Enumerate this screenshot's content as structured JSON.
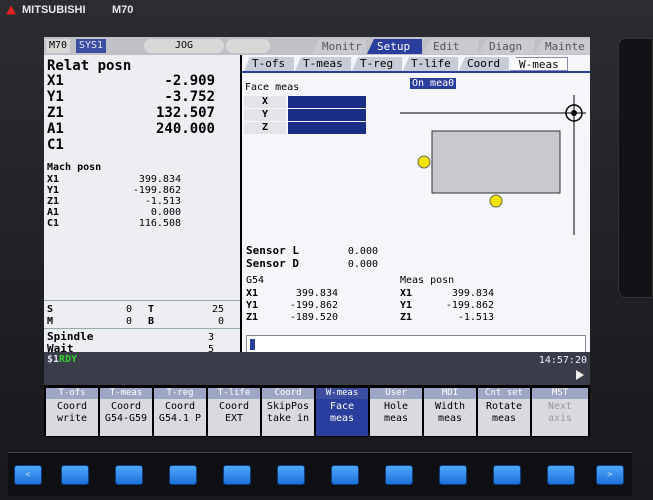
{
  "brand": {
    "name": "MITSUBISHI",
    "model": "M70"
  },
  "topbar": {
    "m70": "M70",
    "sys": "SYS1",
    "mode": "JOG"
  },
  "main_tabs": [
    "Monitr",
    "Setup",
    "Edit",
    "Diagn",
    "Mainte"
  ],
  "active_main_tab": "Setup",
  "sub_tabs": [
    "T-ofs",
    "T-meas",
    "T-reg",
    "T-life",
    "Coord",
    "W-meas"
  ],
  "active_sub_tab": "W-meas",
  "relative": {
    "title": "Relat posn",
    "axes": [
      {
        "name": "X1",
        "value": "-2.909"
      },
      {
        "name": "Y1",
        "value": "-3.752"
      },
      {
        "name": "Z1",
        "value": "132.507"
      },
      {
        "name": "A1",
        "value": "240.000"
      },
      {
        "name": "C1",
        "value": ""
      }
    ]
  },
  "machine": {
    "title": "Mach posn",
    "axes": [
      {
        "name": "X1",
        "value": "399.834"
      },
      {
        "name": "Y1",
        "value": "-199.862"
      },
      {
        "name": "Z1",
        "value": "-1.513"
      },
      {
        "name": "A1",
        "value": "0.000"
      },
      {
        "name": "C1",
        "value": "116.508"
      }
    ]
  },
  "codes": {
    "s_label": "S",
    "s_value": "0",
    "t_label": "T",
    "t_value": "25",
    "m_label": "M",
    "m_value": "0",
    "b_label": "B",
    "b_value": "0"
  },
  "spindle": {
    "label": "Spindle",
    "value": "3"
  },
  "wait": {
    "label": "Wait",
    "value": "5"
  },
  "face": {
    "title": "Face meas",
    "axes": [
      "X",
      "Y",
      "Z"
    ]
  },
  "on_meas": "On mea0",
  "sensor": [
    {
      "label": "Sensor L",
      "value": "0.000"
    },
    {
      "label": "Sensor D",
      "value": "0.000"
    }
  ],
  "g54": {
    "title": "G54",
    "axes": [
      {
        "name": "X1",
        "value": "399.834"
      },
      {
        "name": "Y1",
        "value": "-199.862"
      },
      {
        "name": "Z1",
        "value": "-189.520"
      }
    ]
  },
  "meas": {
    "title": "Meas posn",
    "axes": [
      {
        "name": "X1",
        "value": "399.834"
      },
      {
        "name": "Y1",
        "value": "-199.862"
      },
      {
        "name": "Z1",
        "value": "-1.513"
      }
    ]
  },
  "status": {
    "prefix": "$1",
    "state": "RDY",
    "clock": "14:57:20"
  },
  "softkeys": [
    {
      "top": "T-ofs",
      "bottom1": "Coord",
      "bottom2": "write"
    },
    {
      "top": "T-meas",
      "bottom1": "Coord",
      "bottom2": "G54-G59"
    },
    {
      "top": "T-reg",
      "bottom1": "Coord",
      "bottom2": "G54.1 P"
    },
    {
      "top": "T-life",
      "bottom1": "Coord",
      "bottom2": "EXT"
    },
    {
      "top": "Coord",
      "bottom1": "SkipPos",
      "bottom2": "take in"
    },
    {
      "top": "W-meas",
      "bottom1": "Face",
      "bottom2": "meas"
    },
    {
      "top": "User",
      "bottom1": "Hole",
      "bottom2": "meas"
    },
    {
      "top": "MDI",
      "bottom1": "Width",
      "bottom2": "meas"
    },
    {
      "top": "Cnt set",
      "bottom1": "Rotate",
      "bottom2": "meas"
    },
    {
      "top": "MST",
      "bottom1": "Next",
      "bottom2": "axis"
    }
  ],
  "active_softkey": "Face meas",
  "hw_keys": {
    "left": "<",
    "right": ">"
  },
  "colors": {
    "accent": "#2a3e9e",
    "screen_bg": "#f4f6fb",
    "probe_yellow": "#f5e400"
  }
}
